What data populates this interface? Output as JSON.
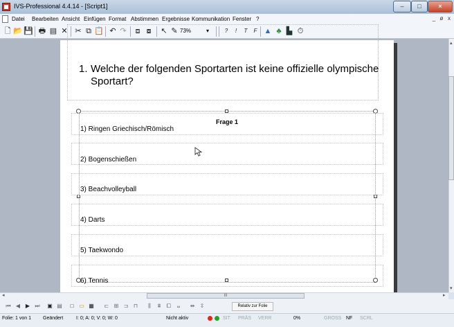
{
  "window": {
    "title": "IVS-Professional 4.4.14 - [Script1]",
    "controls": {
      "minimize": "–",
      "maximize": "□",
      "close": "×"
    }
  },
  "menu": {
    "items": [
      "Datei",
      "Bearbeiten",
      "Ansicht",
      "Einfügen",
      "Format",
      "Abstimmen",
      "Ergebnisse",
      "Kommunikation",
      "Fenster",
      "?"
    ],
    "mdi_controls": [
      "_",
      "ø",
      "x"
    ]
  },
  "toolbar": {
    "zoom": "73%",
    "format_buttons": [
      "?",
      "!",
      "T",
      "F"
    ]
  },
  "slide": {
    "question_number": "1.",
    "question_text": "Welche der folgenden Sportarten ist keine offizielle olympische Sportart?",
    "group_label": "Frage 1",
    "answers": [
      "1) Ringen Griechisch/Römisch",
      "2) Bogenschießen",
      "3) Beachvolleyball",
      "4) Darts",
      "5) Taekwondo",
      "6) Tennis"
    ]
  },
  "scrollbar": {
    "thumb_label": "III"
  },
  "navbar": {
    "relativ_label": "Relativ zur Folie"
  },
  "statusbar": {
    "folie": "Folie: 1 von 1",
    "geaendert": "Geändert",
    "counts": "I: 0;  A: 0;  V: 0;  W: 0",
    "nicht_aktiv": "Nicht aktiv",
    "sit": "SIT",
    "praes": "PRÄS",
    "verr": "VERR",
    "percent": "0%",
    "gross": "GROSS",
    "nf": "NF",
    "scrl": "SCRL"
  },
  "colors": {
    "status_red": "#d62b1f",
    "status_green": "#2e9b2e"
  }
}
